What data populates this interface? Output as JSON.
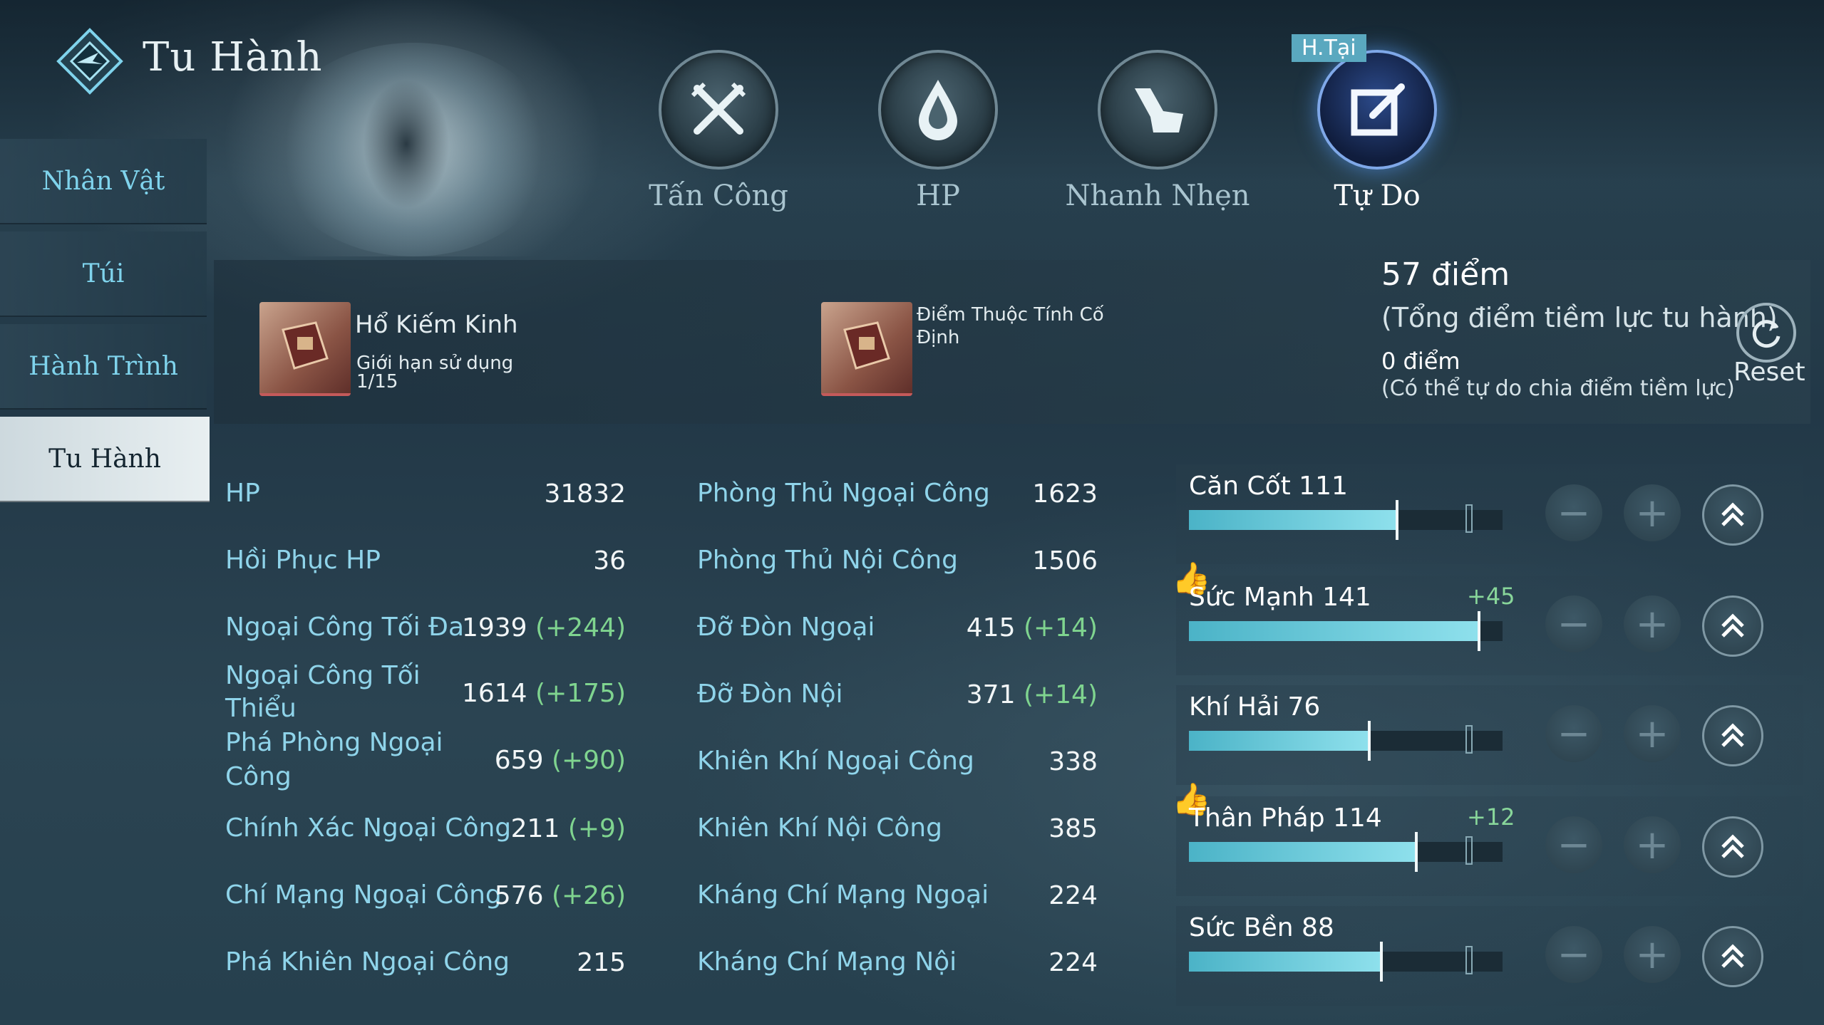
{
  "app": {
    "title": "Tu Hành"
  },
  "sidebar": {
    "items": [
      {
        "label": "Nhân Vật",
        "active": false
      },
      {
        "label": "Túi",
        "active": false
      },
      {
        "label": "Hành Trình",
        "active": false
      },
      {
        "label": "Tu Hành",
        "active": true
      }
    ]
  },
  "categories": {
    "current_badge": "H.Tại",
    "tabs": [
      {
        "label": "Tấn Công",
        "icon": "crossed-swords-icon"
      },
      {
        "label": "HP",
        "icon": "drop-icon"
      },
      {
        "label": "Nhanh Nhẹn",
        "icon": "boot-icon"
      },
      {
        "label": "Tự Do",
        "icon": "edit-icon",
        "active": true
      }
    ]
  },
  "info": {
    "item1": {
      "name": "Hổ Kiếm Kinh",
      "sub1": "Giới hạn sử dụng",
      "sub2": "1/15"
    },
    "item2": {
      "name": "Điểm Thuộc Tính Cố",
      "name2": "Định"
    },
    "total_points": "57 điểm",
    "total_desc": "(Tổng điểm tiềm lực tu hành)",
    "free_points": "0 điểm",
    "free_desc": "(Có thể tự do chia điểm tiềm lực)",
    "reset_label": "Reset"
  },
  "stats_left": [
    {
      "label": "HP",
      "value": "31832",
      "bonus": ""
    },
    {
      "label": "Hồi Phục HP",
      "value": "36",
      "bonus": ""
    },
    {
      "label": "Ngoại Công Tối Đa",
      "value": "1939",
      "bonus": "(+244)"
    },
    {
      "label": "Ngoại Công Tối",
      "label2": "Thiểu",
      "value": "1614",
      "bonus": "(+175)"
    },
    {
      "label": "Phá Phòng Ngoại",
      "label2": "Công",
      "value": "659",
      "bonus": "(+90)"
    },
    {
      "label": "Chính Xác Ngoại Công",
      "value": "211",
      "bonus": "(+9)"
    },
    {
      "label": "Chí Mạng Ngoại Công",
      "value": "576",
      "bonus": "(+26)"
    },
    {
      "label": "Phá Khiên Ngoại Công",
      "value": "215",
      "bonus": ""
    }
  ],
  "stats_right": [
    {
      "label": "Phòng Thủ Ngoại Công",
      "value": "1623",
      "bonus": ""
    },
    {
      "label": "Phòng Thủ Nội Công",
      "value": "1506",
      "bonus": ""
    },
    {
      "label": "Đỡ Đòn Ngoại",
      "value": "415",
      "bonus": "(+14)"
    },
    {
      "label": "Đỡ Đòn Nội",
      "value": "371",
      "bonus": "(+14)"
    },
    {
      "label": "Khiên Khí Ngoại Công",
      "value": "338",
      "bonus": ""
    },
    {
      "label": "Khiên Khí Nội Công",
      "value": "385",
      "bonus": ""
    },
    {
      "label": "Kháng Chí Mạng Ngoại",
      "value": "224",
      "bonus": ""
    },
    {
      "label": "Kháng Chí Mạng Nội",
      "value": "224",
      "bonus": ""
    }
  ],
  "attributes": [
    {
      "label": "Căn Cốt 111",
      "plus": "",
      "recommended": false,
      "fill_fraction": 0.66
    },
    {
      "label": "Sức Mạnh 141",
      "plus": "+45",
      "recommended": true,
      "fill_fraction": 0.92
    },
    {
      "label": "Khí Hải 76",
      "plus": "",
      "recommended": false,
      "fill_fraction": 0.57
    },
    {
      "label": "Thân Pháp 114",
      "plus": "+12",
      "recommended": true,
      "fill_fraction": 0.72
    },
    {
      "label": "Sức Bền 88",
      "plus": "",
      "recommended": false,
      "fill_fraction": 0.61
    }
  ],
  "colors": {
    "accent": "#8fd4ea",
    "bonus": "#7fd48f",
    "active_tab": "#7fa8e8"
  }
}
